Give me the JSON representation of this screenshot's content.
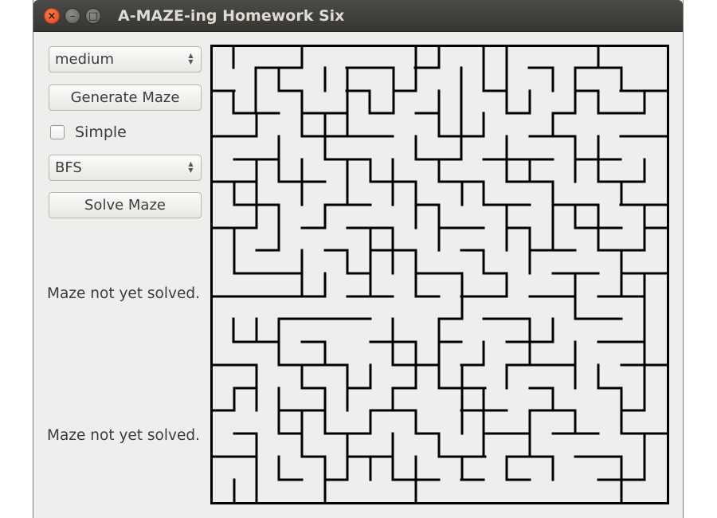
{
  "window": {
    "title": "A-MAZE-ing Homework Six",
    "controls": [
      "close",
      "minimize",
      "maximize"
    ]
  },
  "controls": {
    "size_select": {
      "value": "medium"
    },
    "generate_button": {
      "label": "Generate Maze"
    },
    "simple_checkbox": {
      "label": "Simple",
      "checked": false
    },
    "algorithm_select": {
      "value": "BFS"
    },
    "solve_button": {
      "label": "Solve Maze"
    }
  },
  "status": {
    "first": "Maze not yet solved.",
    "second": "Maze not yet solved."
  },
  "maze": {
    "wall_color": "#000000",
    "background": "#efeeec"
  }
}
